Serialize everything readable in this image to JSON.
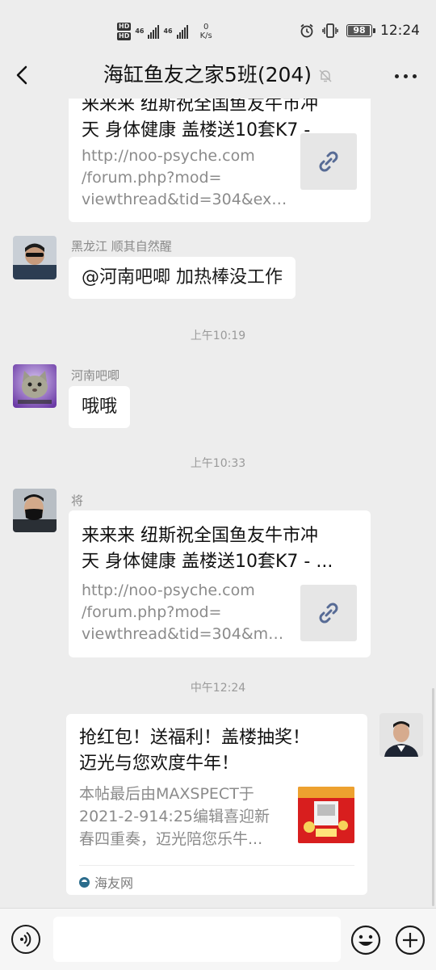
{
  "status_bar": {
    "hd1": "HD",
    "hd2": "HD",
    "net1": "46",
    "net2": "46",
    "speed_value": "0",
    "speed_unit": "K/s",
    "battery": "98",
    "battery_level": 0.98,
    "time": "12:24"
  },
  "header": {
    "title": "海缸鱼友之家5班(204)"
  },
  "messages": {
    "m0": {
      "title_l1": "来来来 纽斯祝全国鱼友牛市冲",
      "title_l2": "天 身体健康 盖楼送10套K7 - ...",
      "desc_l1": "http://noo-psyche.com",
      "desc_l2": "/forum.php?mod=",
      "desc_l3": "viewthread&tid=304&extr..."
    },
    "m1": {
      "sender": "黑龙江 顺其自然醒",
      "text": "@河南吧唧  加热棒没工作"
    },
    "t1": "上午10:19",
    "m2": {
      "sender": "河南吧唧",
      "text": "哦哦"
    },
    "t2": "上午10:33",
    "m3": {
      "sender": "将",
      "title_l1": "来来来 纽斯祝全国鱼友牛市冲",
      "title_l2": "天 身体健康 盖楼送10套K7 - ...",
      "desc_l1": "http://noo-psyche.com",
      "desc_l2": "/forum.php?mod=",
      "desc_l3": "viewthread&tid=304&mo..."
    },
    "t3": "中午12:24",
    "m4": {
      "title_l1": "抢红包！送福利！盖楼抽奖！",
      "title_l2": "迈光与您欢度牛年！",
      "desc_l1": "本帖最后由MAXSPECT于",
      "desc_l2": "2021-2-914:25编辑喜迎新",
      "desc_l3": "春四重奏，迈光陪您乐牛...",
      "source": "海友网"
    }
  },
  "input_bar": {
    "placeholder": ""
  },
  "colors": {
    "background": "#ededed",
    "bubble": "#ffffff",
    "link_icon": "#576b95",
    "muted_text": "#8b8b8b"
  }
}
